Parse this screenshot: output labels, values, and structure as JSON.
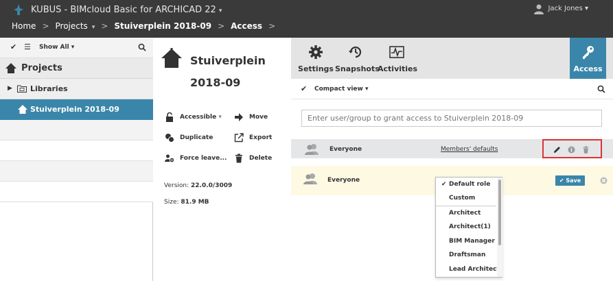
{
  "app": {
    "title": "KUBUS - BIMcloud Basic for ARCHICAD 22",
    "title_caret": "▾",
    "user": "Jack Jones ▾"
  },
  "breadcrumb": {
    "home": "Home",
    "projects": "Projects",
    "projects_caret": "▾",
    "project": "Stuiverplein 2018-09",
    "access": "Access",
    "separator": ">"
  },
  "sidebar": {
    "show_all": "Show All ▾",
    "projects_label": "Projects",
    "libraries_label": "Libraries",
    "selected_project": "Stuiverplein 2018-09"
  },
  "project_panel": {
    "title": "Stuiverplein 2018-09",
    "actions": {
      "accessible": "Accessible",
      "accessible_caret": "▾",
      "move": "Move",
      "duplicate": "Duplicate",
      "export": "Export",
      "force_leave": "Force leave...",
      "delete": "Delete"
    },
    "version_label": "Version:",
    "version_value": "22.0.0/3009",
    "size_label": "Size:",
    "size_value": "81.9 MB"
  },
  "tabs": [
    {
      "label": "Settings",
      "icon": "gear-icon"
    },
    {
      "label": "Snapshots",
      "icon": "snapshots-icon"
    },
    {
      "label": "Activities",
      "icon": "activity-icon"
    },
    {
      "label": "Access",
      "icon": "key-icon"
    }
  ],
  "access": {
    "compact_view": "Compact view ▾",
    "grant_placeholder": "Enter user/group to grant access to Stuiverplein 2018-09",
    "row1": {
      "name": "Everyone",
      "role": "Members' defaults"
    },
    "row2": {
      "name": "Everyone",
      "save_label": "Save"
    }
  },
  "role_dropdown": {
    "selected": "Default role",
    "options": [
      "Default role",
      "Custom",
      "Architect",
      "Architect(1)",
      "BIM Manager",
      "Draftsman",
      "Lead Architect"
    ]
  },
  "colors": {
    "topbar": "#3a3a3a",
    "accent": "#3a86aa",
    "highlight_border": "#dd3333",
    "edit_row_bg": "#fdf9e3"
  }
}
